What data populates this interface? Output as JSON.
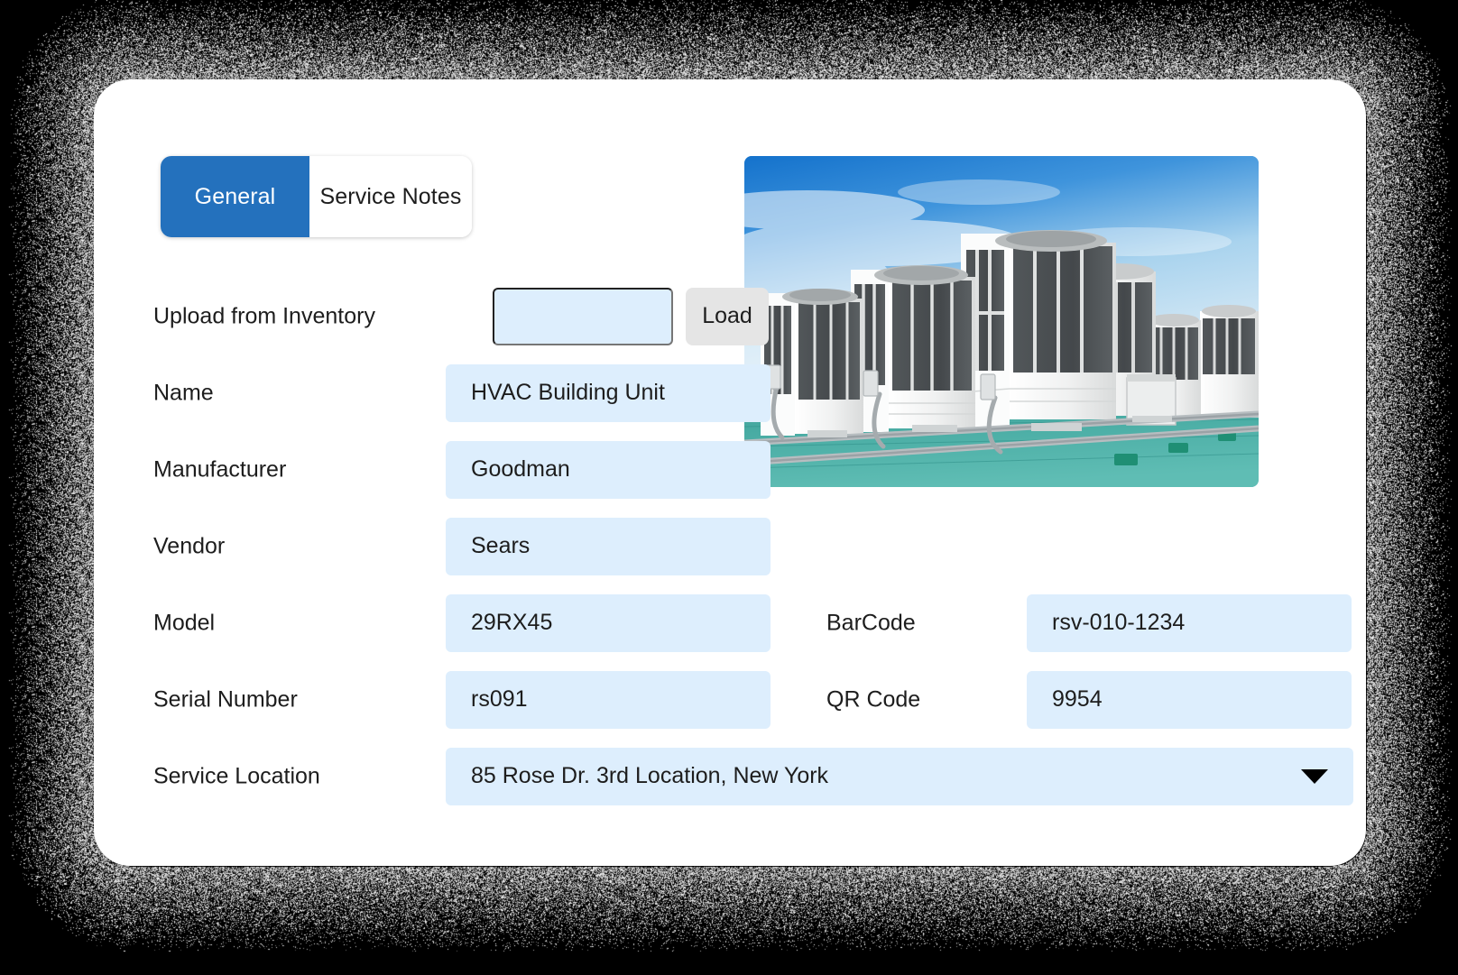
{
  "theme": {
    "accent": "#2471bd",
    "field_bg": "#ddeefd",
    "button_bg": "#e5e5e5",
    "card_bg": "#ffffff",
    "text": "#1d1d1d"
  },
  "tabs": [
    {
      "id": "general",
      "label": "General",
      "active": true
    },
    {
      "id": "service-notes",
      "label": "Service Notes",
      "active": false
    }
  ],
  "form": {
    "upload": {
      "label": "Upload from Inventory",
      "value": "",
      "placeholder": "",
      "button_label": "Load"
    },
    "name": {
      "label": "Name",
      "value": "HVAC Building Unit"
    },
    "manufacturer": {
      "label": "Manufacturer",
      "value": "Goodman"
    },
    "vendor": {
      "label": "Vendor",
      "value": "Sears"
    },
    "model": {
      "label": "Model",
      "value": "29RX45"
    },
    "barcode": {
      "label": "BarCode",
      "value": "rsv-010-1234"
    },
    "serial_number": {
      "label": "Serial Number",
      "value": "rs091"
    },
    "qr_code": {
      "label": "QR Code",
      "value": "9954"
    },
    "service_location": {
      "label": "Service Location",
      "value": "85 Rose Dr. 3rd Location, New York",
      "caret_icon": "chevron-down-icon"
    }
  },
  "photo": {
    "alt": "Rooftop HVAC condenser units under blue sky",
    "sky_color": "#1b7ed1",
    "roof_color": "#2e9b96",
    "unit_color": "#f1f2f2",
    "coil_color": "#4b4f52"
  }
}
